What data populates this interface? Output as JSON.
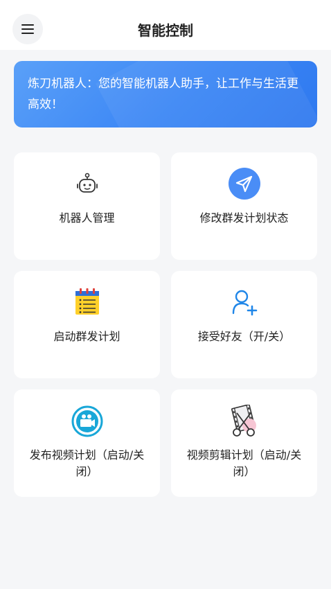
{
  "header": {
    "title": "智能控制",
    "menu_icon": "hamburger-menu-icon"
  },
  "banner": {
    "text": "炼刀机器人：您的智能机器人助手，让工作与生活更高效！"
  },
  "cards": [
    {
      "label": "机器人管理",
      "icon": "robot-icon"
    },
    {
      "label": "修改群发计划状态",
      "icon": "send-icon"
    },
    {
      "label": "启动群发计划",
      "icon": "calendar-checklist-icon"
    },
    {
      "label": "接受好友（开/关）",
      "icon": "add-friend-icon"
    },
    {
      "label": "发布视频计划（启动/关闭）",
      "icon": "video-camera-icon"
    },
    {
      "label": "视频剪辑计划（启动/关闭）",
      "icon": "video-edit-icon"
    }
  ],
  "colors": {
    "accent": "#3b86f5",
    "send_icon_bg": "#4a8df6",
    "video_icon": "#19a7d8",
    "calendar_yellow": "#ffd02a"
  }
}
